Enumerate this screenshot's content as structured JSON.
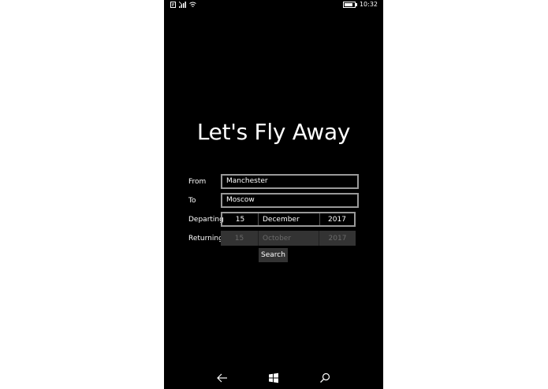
{
  "status_bar": {
    "time": "10:32",
    "battery_level": 0.85,
    "icons": [
      "notification-icon",
      "signal-icon",
      "wifi-icon",
      "battery-icon"
    ]
  },
  "app": {
    "title": "Let's Fly Away"
  },
  "form": {
    "from": {
      "label": "From",
      "value": "Manchester"
    },
    "to": {
      "label": "To",
      "value": "Moscow"
    },
    "departing": {
      "label": "Departing",
      "day": "15",
      "month": "December",
      "year": "2017"
    },
    "returning": {
      "label": "Returning",
      "day": "15",
      "month": "October",
      "year": "2017"
    },
    "search_label": "Search"
  },
  "nav_bar": {
    "icons": [
      "back-arrow-icon",
      "windows-start-icon",
      "search-icon"
    ]
  },
  "colors": {
    "background": "#000000",
    "text": "#ffffff",
    "input_border": "#999999",
    "disabled_bg": "#333333",
    "disabled_text": "#6a6a6a"
  }
}
